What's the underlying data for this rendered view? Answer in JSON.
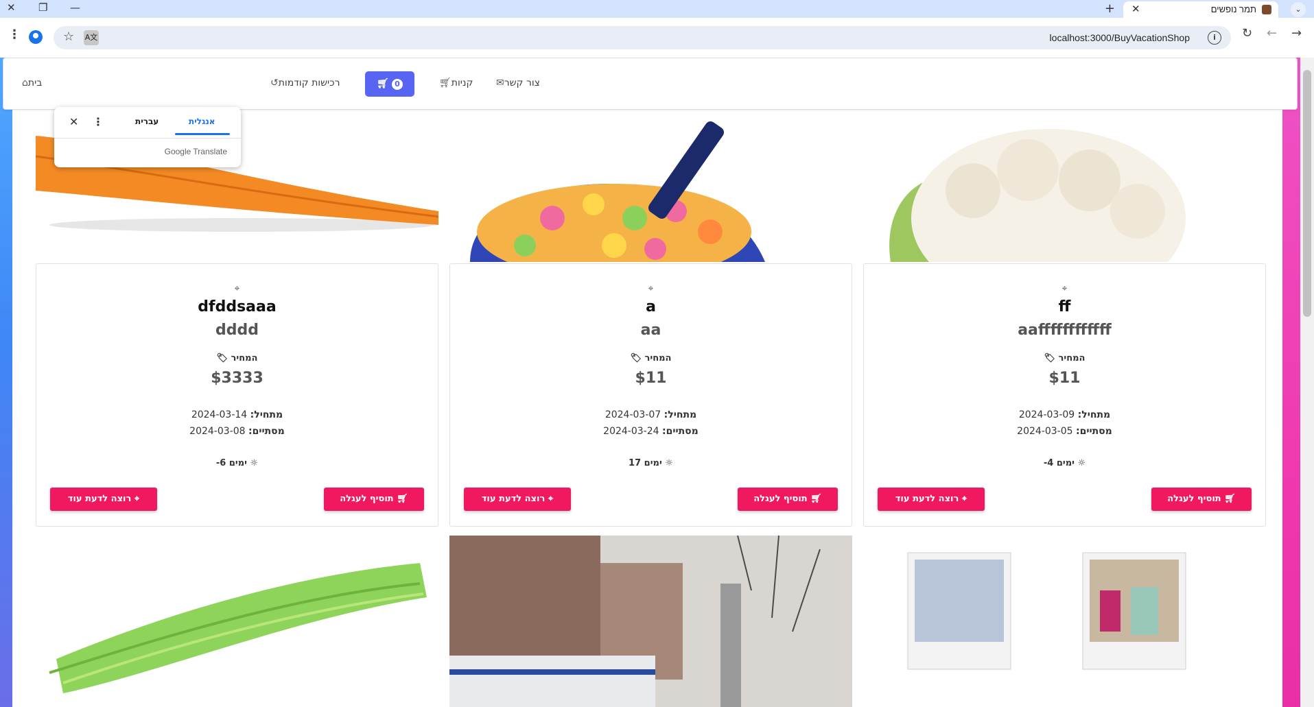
{
  "browser": {
    "tab_title": "תמר נופשים",
    "url": "localhost:3000/BuyVacationShop"
  },
  "navbar": {
    "home": "בית",
    "history": "רכישות קודמות",
    "cart_count": "0",
    "shopping": "קניות",
    "contact": "צור קשר"
  },
  "translate_popup": {
    "lang_english": "אנגלית",
    "lang_hebrew": "עברית",
    "brand": "Google Translate"
  },
  "cards": [
    {
      "title": "ff",
      "subtitle": "aaffffffffffff",
      "price_label": "המחיר",
      "price": "$11",
      "start_label": "מתחיל:",
      "start": "2024-03-09",
      "end_label": "מסתיים:",
      "end": "2024-03-05",
      "days": "ימים 4-",
      "add_label": "תוסיף לעגלה",
      "more_label": "רוצה לדעת עוד",
      "image": "cauliflower"
    },
    {
      "title": "a",
      "subtitle": "aa",
      "price_label": "המחיר",
      "price": "$11",
      "start_label": "מתחיל:",
      "start": "2024-03-07",
      "end_label": "מסתיים:",
      "end": "2024-03-24",
      "days": "ימים 17",
      "add_label": "תוסיף לעגלה",
      "more_label": "רוצה לדעת עוד",
      "image": "cereal-bowl"
    },
    {
      "title": "dfddsaaa",
      "subtitle": "dddd",
      "price_label": "המחיר",
      "price": "$3333",
      "start_label": "מתחיל:",
      "start": "2024-03-14",
      "end_label": "מסתיים:",
      "end": "2024-03-08",
      "days": "ימים 6-",
      "add_label": "תוסיף לעגלה",
      "more_label": "רוצה לדעת עוד",
      "image": "carrot"
    }
  ],
  "icons": {
    "location": "map-pin-icon",
    "tag": "price-tag-icon",
    "sun": "sun-icon",
    "cart": "cart-icon"
  }
}
